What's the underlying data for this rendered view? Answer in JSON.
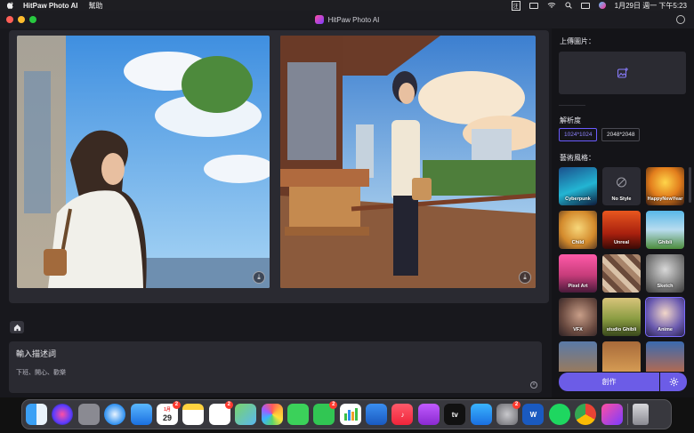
{
  "menubar": {
    "app_name": "HitPaw Photo AI",
    "menu_help": "幫助",
    "input_method": "注",
    "datetime": "1月29日 週一 下午5:23"
  },
  "window": {
    "title": "HitPaw Photo AI"
  },
  "prompt": {
    "label": "輸入描述詞",
    "value": "下班、開心、歡樂"
  },
  "panel": {
    "upload_title": "上傳圖片：",
    "resolution_title": "解析度",
    "resolutions": [
      "1024*1024",
      "2048*2048"
    ],
    "art_style_title": "藝術風格：",
    "styles": [
      "Cyberpunk",
      "No Style",
      "HappyNewYear",
      "Child",
      "Unreal",
      "Ghibli",
      "Pixel Art",
      "",
      "Sketch",
      "VFX",
      "studio Ghibli",
      "Anime"
    ],
    "create_label": "創作"
  },
  "dock": {
    "calendar_month": "1月",
    "calendar_day": "29",
    "badges": {
      "calendar": "2",
      "reminders": "2",
      "facetime": "2",
      "settings": "2"
    },
    "tv_label": "tv",
    "word_label": "W"
  },
  "colors": {
    "accent": "#6c5ce7",
    "panel_bg": "#141418",
    "card_bg": "#2a2a31"
  }
}
